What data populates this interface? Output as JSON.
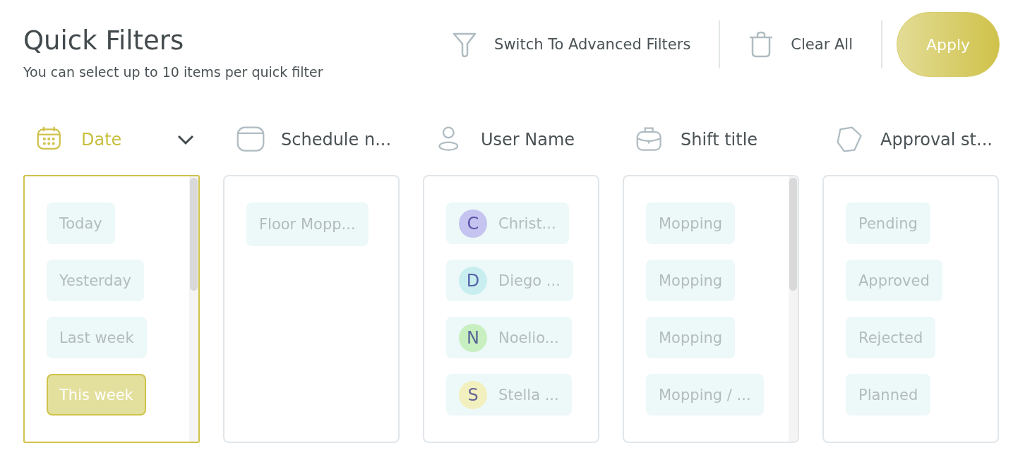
{
  "header": {
    "title": "Quick Filters",
    "subtitle": "You can select up to 10 items per quick filter"
  },
  "actions": {
    "advanced": "Switch To Advanced Filters",
    "clear": "Clear All",
    "apply": "Apply"
  },
  "columns": [
    {
      "kind": "calendar",
      "label": "Date",
      "active": true,
      "scrollable": true,
      "items": [
        {
          "label": "Today",
          "selected": false
        },
        {
          "label": "Yesterday",
          "selected": false
        },
        {
          "label": "Last week",
          "selected": false
        },
        {
          "label": "This week",
          "selected": true
        }
      ]
    },
    {
      "kind": "window",
      "label": "Schedule n...",
      "active": false,
      "scrollable": false,
      "items": [
        {
          "label": "Floor Mopp...",
          "selected": false
        }
      ]
    },
    {
      "kind": "person",
      "label": "User Name",
      "active": false,
      "scrollable": false,
      "items": [
        {
          "label": "Christ...",
          "selected": false,
          "avatar": "C",
          "color": "#c5c3f0"
        },
        {
          "label": "Diego ...",
          "selected": false,
          "avatar": "D",
          "color": "#c9eef0"
        },
        {
          "label": "Noelio...",
          "selected": false,
          "avatar": "N",
          "color": "#c8efc0"
        },
        {
          "label": "Stella ...",
          "selected": false,
          "avatar": "S",
          "color": "#f3f0bf"
        }
      ]
    },
    {
      "kind": "bag",
      "label": "Shift title",
      "active": false,
      "scrollable": true,
      "items": [
        {
          "label": "Mopping",
          "selected": false
        },
        {
          "label": "Mopping",
          "selected": false
        },
        {
          "label": "Mopping",
          "selected": false
        },
        {
          "label": "Mopping / ...",
          "selected": false
        }
      ]
    },
    {
      "kind": "tag",
      "label": "Approval st...",
      "active": false,
      "scrollable": false,
      "items": [
        {
          "label": "Pending",
          "selected": false
        },
        {
          "label": "Approved",
          "selected": false
        },
        {
          "label": "Rejected",
          "selected": false
        },
        {
          "label": "Planned",
          "selected": false
        }
      ]
    }
  ]
}
